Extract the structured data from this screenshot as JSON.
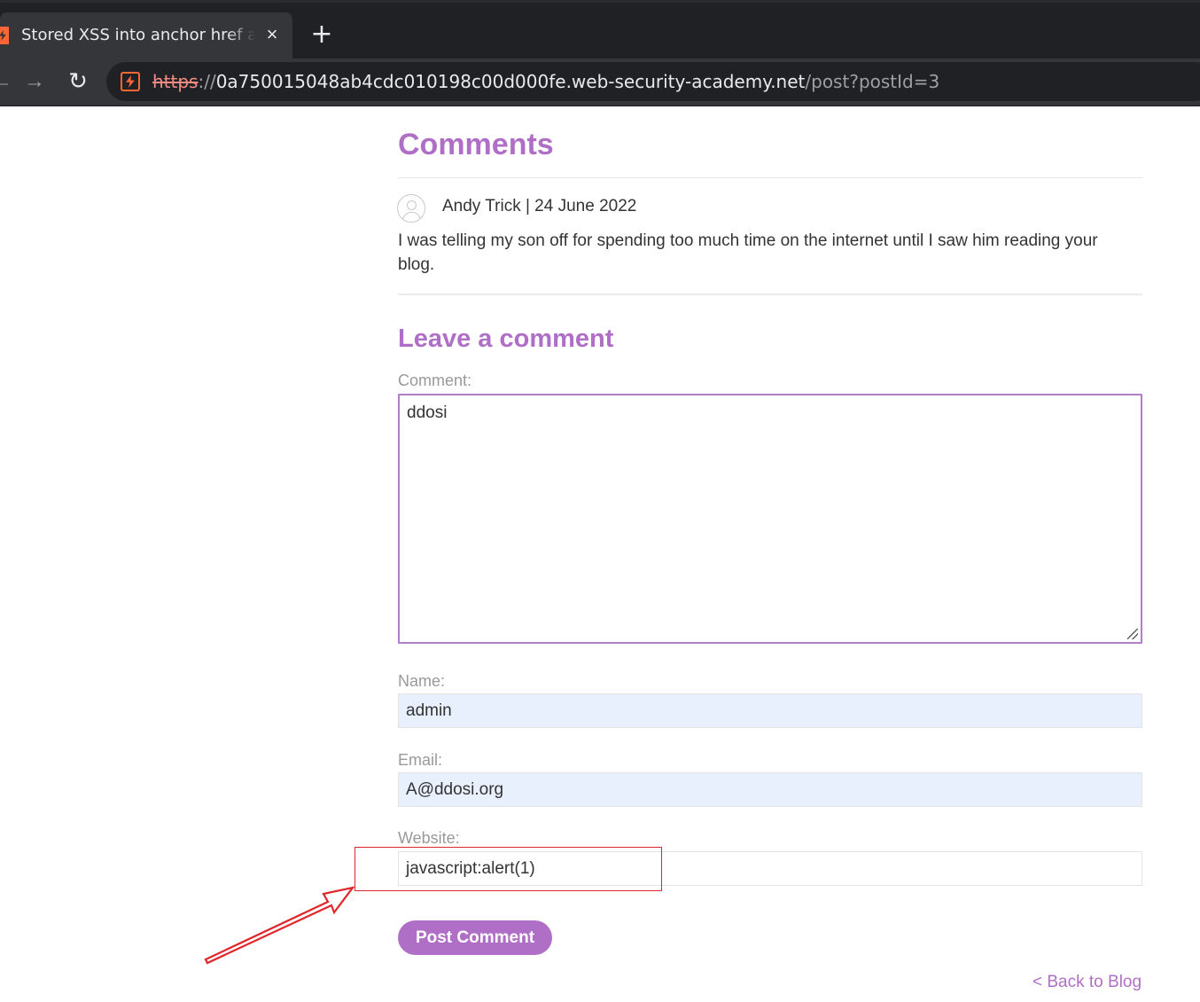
{
  "browser": {
    "tab_title": "Stored XSS into anchor href attribute with double quotes HTML-encoded",
    "tab_close": "×",
    "new_tab": "+",
    "url_scheme": "https",
    "url_separator": "://",
    "url_host": "0a750015048ab4cdc010198c00d000fe.web-security-academy.net",
    "url_path": "/post?postId=3",
    "colors": {
      "insecure_scheme": "#f28b82",
      "favicon": "#ff6633"
    }
  },
  "comments": {
    "title": "Comments",
    "items": [
      {
        "meta": "Andy Trick | 24 June 2022",
        "text": "I was telling my son off for spending too much time on the internet until I saw him reading your blog."
      }
    ]
  },
  "form": {
    "title": "Leave a comment",
    "comment_label": "Comment:",
    "comment_value": "ddosi",
    "name_label": "Name:",
    "name_value": "admin",
    "email_label": "Email:",
    "email_value": "A@ddosi.org",
    "website_label": "Website:",
    "website_value": "javascript:alert(1)",
    "submit_label": "Post Comment"
  },
  "back_link": "< Back to Blog",
  "annotation": {
    "color": "#e0262a"
  },
  "theme": {
    "accent": "#b06fc6",
    "autofill_bg": "#e8f0fe"
  }
}
